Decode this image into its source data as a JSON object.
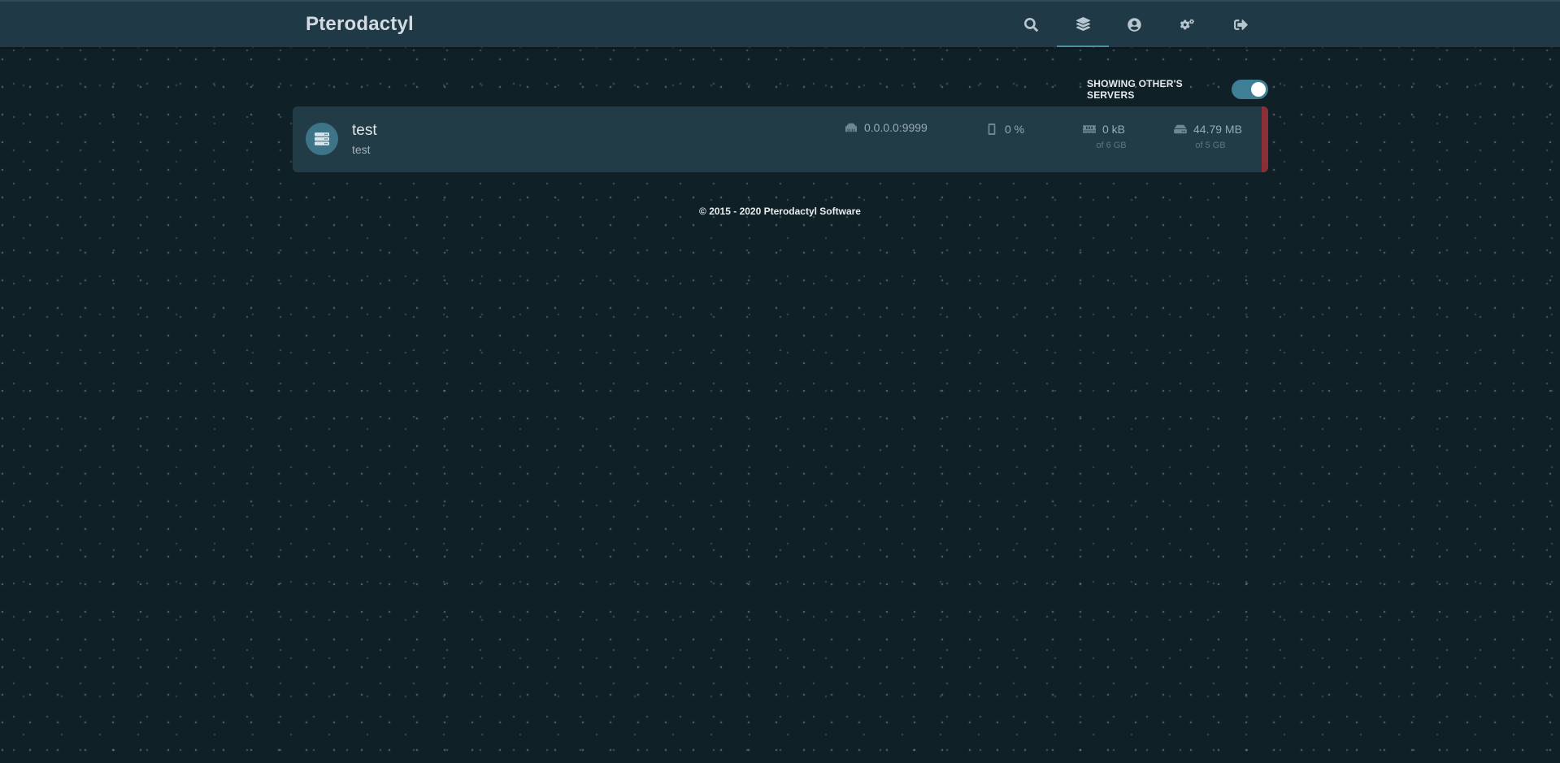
{
  "navbar": {
    "brand": "Pterodactyl",
    "items": [
      {
        "icon": "search-icon",
        "active": false
      },
      {
        "icon": "layers-icon",
        "active": true
      },
      {
        "icon": "user-circle-icon",
        "active": false
      },
      {
        "icon": "cogs-icon",
        "active": false
      },
      {
        "icon": "sign-out-icon",
        "active": false
      }
    ]
  },
  "toggle": {
    "label": "SHOWING OTHER'S SERVERS",
    "checked": true
  },
  "servers": [
    {
      "name": "test",
      "description": "test",
      "address": "0.0.0.0:9999",
      "cpu": "0 %",
      "memory": "0 kB",
      "memory_limit": "of 6 GB",
      "disk": "44.79 MB",
      "disk_limit": "of 5 GB",
      "status_color": "#8b2e38",
      "icon": "server-icon"
    }
  ],
  "footer": {
    "text": "© 2015 - 2020 Pterodactyl Software"
  },
  "colors": {
    "background": "#0f2027",
    "navbar": "#1f3a46",
    "card": "#213b47",
    "accent": "#3f7f95",
    "status_offline": "#8b2e38"
  }
}
